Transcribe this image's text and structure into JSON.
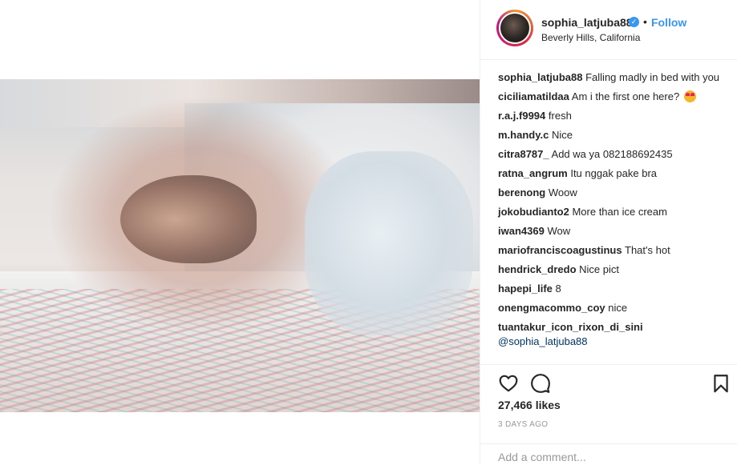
{
  "post": {
    "username": "sophia_latjuba88",
    "verified_icon": "verified-badge-icon",
    "separator": "•",
    "follow_label": "Follow",
    "location": "Beverly Hills, California"
  },
  "comments": [
    {
      "user": "sophia_latjuba88",
      "text": "Falling madly in bed with you"
    },
    {
      "user": "ciciliamatildaa",
      "text": "Am i the first one here?",
      "emoji": "heart-eyes-emoji"
    },
    {
      "user": "r.a.j.f9994",
      "text": "fresh"
    },
    {
      "user": "m.handy.c",
      "text": "Nice"
    },
    {
      "user": "citra8787_",
      "text": "Add wa ya 082188692435"
    },
    {
      "user": "ratna_angrum",
      "text": "Itu nggak pake bra"
    },
    {
      "user": "berenong",
      "text": "Woow"
    },
    {
      "user": "jokobudianto2",
      "text": "More than ice cream"
    },
    {
      "user": "iwan4369",
      "text": "Wow"
    },
    {
      "user": "mariofranciscoagustinus",
      "text": "That's hot"
    },
    {
      "user": "hendrick_dredo",
      "text": "Nice pict"
    },
    {
      "user": "hapepi_life",
      "text": "8"
    },
    {
      "user": "onengmacommo_coy",
      "text": "nice"
    },
    {
      "user": "tuantakur_icon_rixon_di_sini",
      "text": "",
      "mention": "@sophia_latjuba88"
    }
  ],
  "actions": {
    "like_icon": "heart-icon",
    "comment_icon": "comment-icon",
    "save_icon": "bookmark-icon",
    "likes": "27,466 likes",
    "time": "3 DAYS AGO"
  },
  "add_comment": {
    "placeholder": "Add a comment..."
  },
  "colors": {
    "accent": "#3897f0",
    "text": "#262626",
    "muted": "#999999",
    "mention": "#003569",
    "border": "#efefef"
  }
}
